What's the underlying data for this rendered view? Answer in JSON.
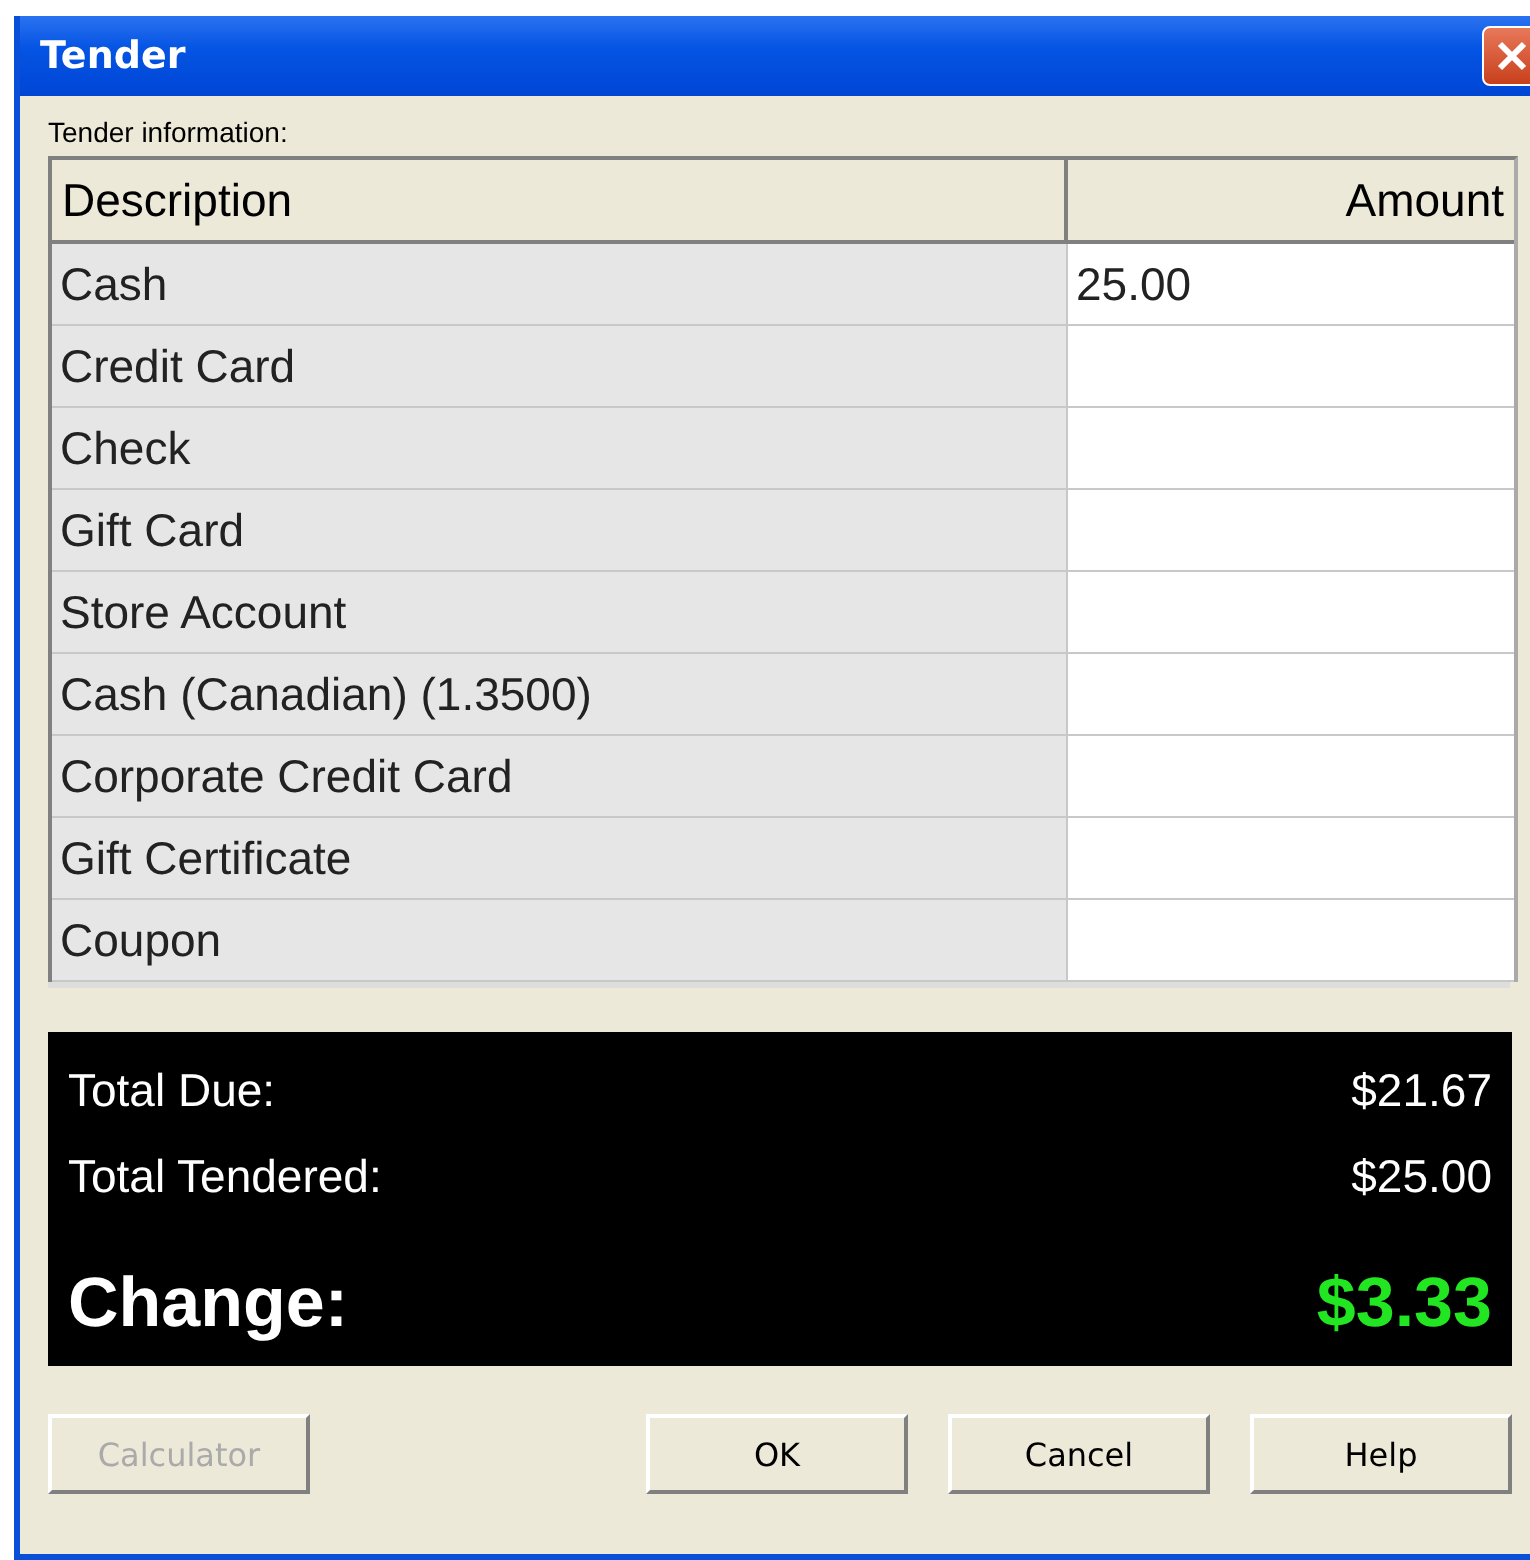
{
  "window": {
    "title": "Tender"
  },
  "tender_label": "Tender information:",
  "table": {
    "columns": [
      "Description",
      "Amount"
    ],
    "rows": [
      {
        "description": "Cash",
        "amount": "25.00"
      },
      {
        "description": "Credit Card"
      },
      {
        "description": "Check"
      },
      {
        "description": "Gift Card"
      },
      {
        "description": "Store Account"
      },
      {
        "description": "Cash (Canadian) (1.3500)"
      },
      {
        "description": "Corporate Credit Card"
      },
      {
        "description": "Gift Certificate"
      },
      {
        "description": "Coupon"
      }
    ]
  },
  "totals": {
    "due_label": "Total Due:",
    "due": "$21.67",
    "tendered_label": "Total Tendered:",
    "tendered": "$25.00",
    "change_label": "Change:",
    "change": "$3.33"
  },
  "buttons": [
    {
      "label": "Calculator",
      "disabled": true
    },
    {
      "label": "OK",
      "disabled": false
    },
    {
      "label": "Cancel",
      "disabled": false
    },
    {
      "label": "Help",
      "disabled": false
    }
  ]
}
